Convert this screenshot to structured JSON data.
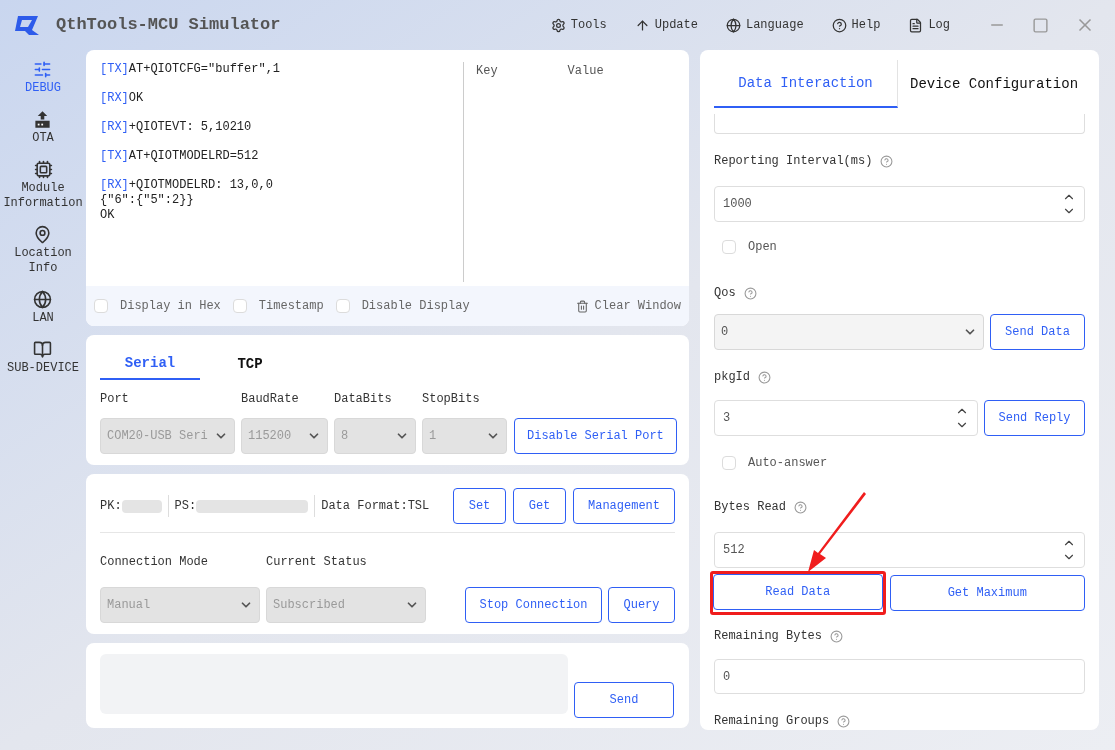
{
  "window": {
    "title": "QthTools-MCU Simulator"
  },
  "toolbar": [
    {
      "kind": "gear",
      "label": "Tools"
    },
    {
      "kind": "upload",
      "label": "Update"
    },
    {
      "kind": "globe",
      "label": "Language"
    },
    {
      "kind": "help",
      "label": "Help"
    },
    {
      "kind": "log",
      "label": "Log"
    }
  ],
  "sidebar": {
    "items": [
      {
        "kind": "sliders",
        "label": "DEBUG",
        "selected": true
      },
      {
        "kind": "ota",
        "label": "OTA",
        "selected": false
      },
      {
        "kind": "chip",
        "label": "Module\nInformation",
        "selected": false
      },
      {
        "kind": "pin",
        "label": "Location\nInfo",
        "selected": false
      },
      {
        "kind": "globe",
        "label": "LAN",
        "selected": false
      },
      {
        "kind": "book",
        "label": "SUB-DEVICE",
        "selected": false
      }
    ]
  },
  "log": {
    "lines": [
      {
        "tag": "[TX]",
        "text": "AT+QIOTCFG=\"buffer\",1"
      },
      {
        "tag": "[RX]",
        "text": "OK"
      },
      {
        "tag": "[RX]",
        "text": "+QIOTEVT: 5,10210"
      },
      {
        "tag": "[TX]",
        "text": "AT+QIOTMODELRD=512"
      },
      {
        "tag": "[RX]",
        "text": "+QIOTMODELRD: 13,0,0\n{\"6\":{\"5\":2}}\nOK"
      }
    ],
    "kv_columns": [
      "Key",
      "Value"
    ],
    "options": [
      {
        "label": "Display in Hex",
        "checked": false
      },
      {
        "label": "Timestamp",
        "checked": false
      },
      {
        "label": "Disable Display",
        "checked": false
      }
    ],
    "clear_button": "Clear Window"
  },
  "connection_tabs": [
    {
      "label": "Serial",
      "selected": true
    },
    {
      "label": "TCP",
      "selected": false
    }
  ],
  "serial": {
    "fields": [
      {
        "label": "Port",
        "value": "COM20-USB Seri"
      },
      {
        "label": "BaudRate",
        "value": "115200"
      },
      {
        "label": "DataBits",
        "value": "8"
      },
      {
        "label": "StopBits",
        "value": "1"
      }
    ],
    "button": "Disable Serial Port"
  },
  "product": {
    "pk_label": "PK:",
    "ps_label": "PS:",
    "format": "Data Format:TSL",
    "buttons": [
      "Set",
      "Get",
      "Management"
    ],
    "fields": [
      {
        "label": "Connection Mode",
        "value": "Manual"
      },
      {
        "label": "Current Status",
        "value": "Subscribed"
      }
    ],
    "actions": [
      "Stop Connection",
      "Query"
    ]
  },
  "send_box": {
    "button": "Send"
  },
  "right_panel": {
    "tabs": [
      {
        "label": "Data Interaction",
        "selected": true
      },
      {
        "label": "Device Configuration",
        "selected": false
      }
    ],
    "reporting": {
      "label": "Reporting Interval(ms)",
      "value": "1000",
      "open_label": "Open",
      "open_checked": false
    },
    "qos": {
      "label": "Qos",
      "value": "0",
      "button": "Send Data"
    },
    "pkgid": {
      "label": "pkgId",
      "value": "3",
      "button": "Send Reply",
      "auto_label": "Auto-answer",
      "auto_checked": false
    },
    "bytes_read": {
      "label": "Bytes Read",
      "value": "512",
      "buttons": [
        {
          "label": "Read Data",
          "highlighted": true
        },
        {
          "label": "Get Maximum",
          "highlighted": false
        }
      ]
    },
    "remaining_bytes": {
      "label": "Remaining Bytes",
      "value": "0"
    },
    "remaining_groups": {
      "label": "Remaining Groups"
    }
  }
}
